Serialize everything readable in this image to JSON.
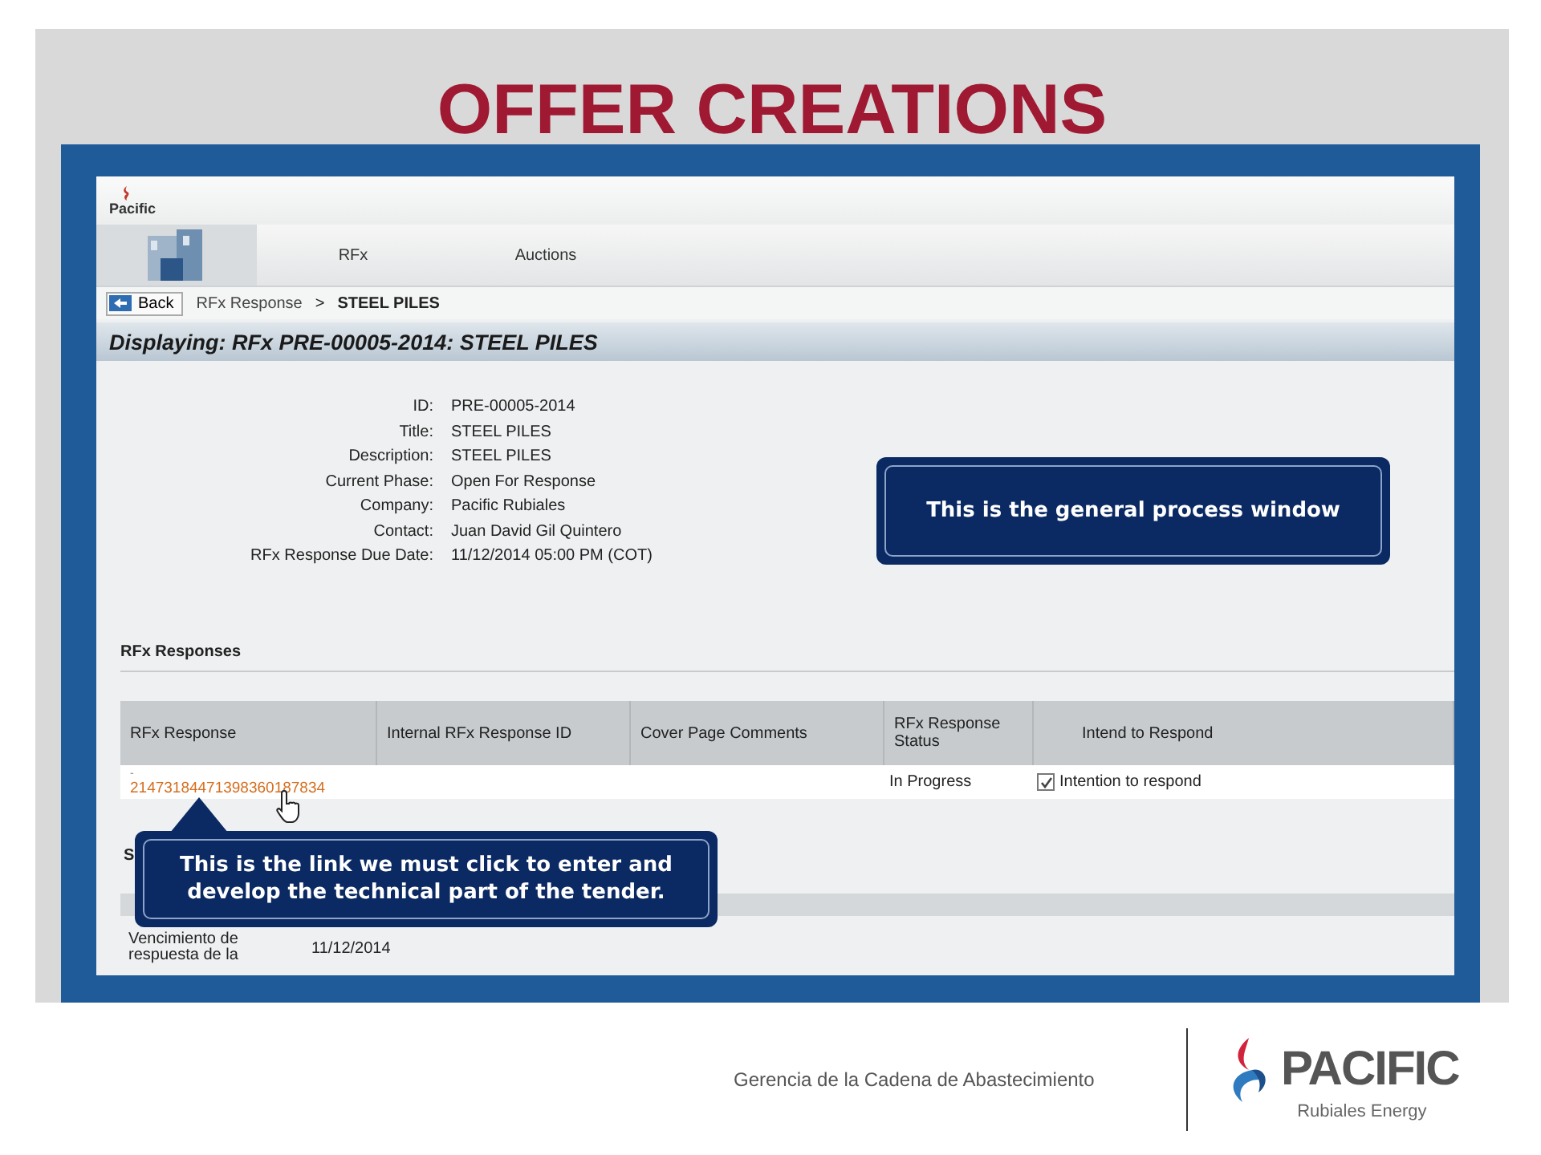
{
  "slide": {
    "title": "OFFER CREATIONS",
    "footer_text": "Gerencia de la Cadena de Abastecimiento",
    "logo_name": "PACIFIC",
    "logo_tagline": "Rubiales Energy"
  },
  "screen": {
    "header_logo": "Pacific",
    "tabs": [
      {
        "label": "RFx",
        "selected": false
      },
      {
        "label": "Auctions",
        "selected": false
      }
    ],
    "back_button": "Back",
    "breadcrumb": {
      "link": "RFx Response",
      "separator": ">",
      "current": "STEEL PILES"
    },
    "page_title": "Displaying: RFx PRE-00005-2014: STEEL PILES",
    "details": [
      {
        "label": "ID:",
        "value": "PRE-00005-2014"
      },
      {
        "label": "Title:",
        "value": "STEEL PILES"
      },
      {
        "label": "Description:",
        "value": "STEEL PILES"
      },
      {
        "label": "Current Phase:",
        "value": "Open For Response"
      },
      {
        "label": "Company:",
        "value": "Pacific Rubiales"
      },
      {
        "label": "Contact:",
        "value": "Juan David Gil Quintero"
      },
      {
        "label": "RFx Response Due Date:",
        "value": "11/12/2014 05:00 PM (COT)"
      }
    ],
    "responses": {
      "heading": "RFx Responses",
      "columns": [
        "RFx Response",
        "Internal RFx Response ID",
        "Cover Page Comments",
        "RFx Response Status",
        "Intend to Respond"
      ],
      "rows": [
        {
          "dash": "-",
          "response_link": "21473184471398360187834",
          "status": "In Progress",
          "intend_checked": true,
          "intend_label": "Intention to respond"
        }
      ]
    },
    "section_2": {
      "heading": "S",
      "rows": [
        {
          "label": "Vencimiento de respuesta de la",
          "value": "11/12/2014"
        }
      ]
    }
  },
  "callouts": [
    {
      "text": "This is the general process window"
    },
    {
      "text": "This is the link we must click to enter and develop the technical part of the tender."
    }
  ]
}
